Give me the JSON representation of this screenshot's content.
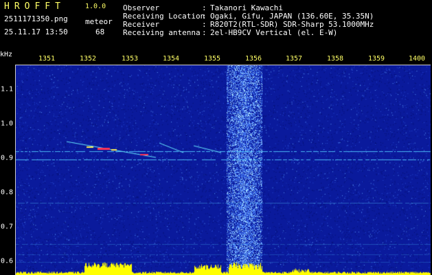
{
  "app": {
    "title": "HROFFT",
    "version": "1.0.0",
    "filename": "2511171350.png",
    "datetime": "25.11.17 13:50",
    "detection_label": "meteor",
    "detection_count": "68"
  },
  "info": [
    {
      "label": "Observer",
      "value": "Takanori Kawachi"
    },
    {
      "label": "Receiving Location",
      "value": "Ogaki, Gifu, JAPAN (136.60E, 35.35N)"
    },
    {
      "label": "Receiver",
      "value": "R820T2(RTL-SDR) SDR-Sharp 53.1000MHz"
    },
    {
      "label": "Receiving antenna",
      "value": "2el-HB9CV Vertical (el. E-W)"
    }
  ],
  "axis": {
    "unit_label": "kHz",
    "x_ticks": [
      "1351",
      "1352",
      "1353",
      "1354",
      "1355",
      "1356",
      "1357",
      "1358",
      "1359",
      "1400"
    ],
    "y_ticks": [
      "1.1",
      "1.0",
      "0.9",
      "0.8",
      "0.7",
      "0.6"
    ]
  },
  "colors": {
    "background": "#000000",
    "spectrogram_base": "#0a1a9c",
    "accent": "#ffff66",
    "signal": "#00ffff",
    "echo_hot": "#ff3355"
  }
}
